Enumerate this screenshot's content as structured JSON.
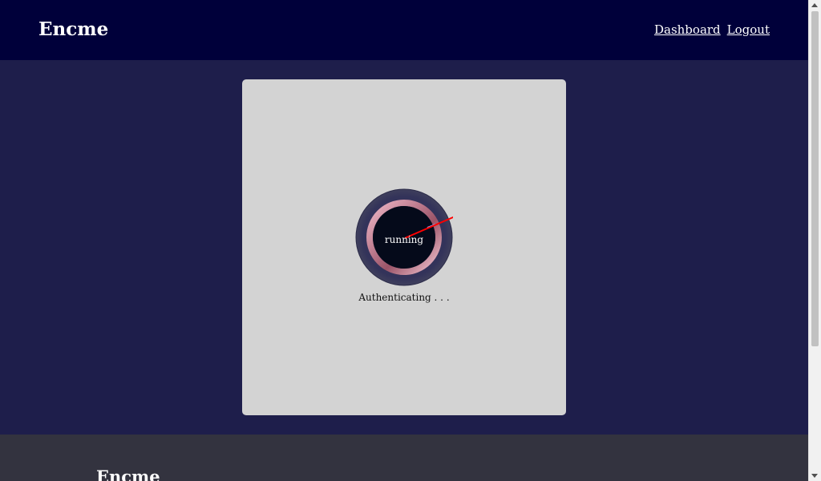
{
  "header": {
    "brand": "Encme",
    "nav": [
      {
        "label": "Dashboard"
      },
      {
        "label": "Logout"
      }
    ]
  },
  "main": {
    "spinner": {
      "label": "running",
      "colors": {
        "outer": "#33335a",
        "ring": "#b06a7e",
        "core": "#050a1a",
        "needle": "#ff0000"
      }
    },
    "status": "Authenticating . . ."
  },
  "footer": {
    "brand": "Encme"
  },
  "colors": {
    "header_bg": "#00003a",
    "main_bg": "#1e1e4b",
    "card_bg": "#d3d3d3",
    "footer_bg": "#33333f"
  },
  "icons": {
    "spinner": "loading-dial-icon",
    "needle": "needle-icon"
  }
}
